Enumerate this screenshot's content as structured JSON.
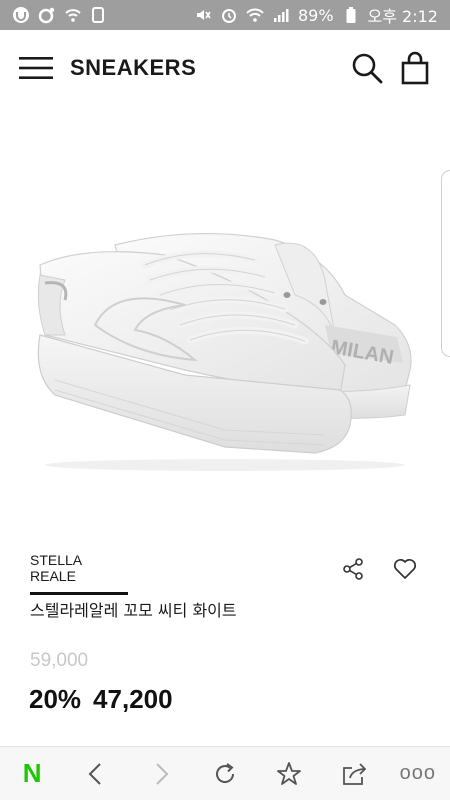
{
  "status_bar": {
    "battery": "89%",
    "time": "오후 2:12"
  },
  "header": {
    "title": "SNEAKERS"
  },
  "product": {
    "brand": "STELLA REALE",
    "name": "스텔라레알레 꼬모 씨티 화이트",
    "original_price": "59,000",
    "discount": "20%",
    "sale_price": "47,200",
    "shoe_print": "MILAN"
  },
  "browser_toolbar": {
    "naver_logo": "N",
    "more": "ooo"
  },
  "colors": {
    "status_bar_bg": "#9e9e9e",
    "naver_green": "#1ec800",
    "text_primary": "#111111",
    "price_muted": "#c8c8c8"
  }
}
